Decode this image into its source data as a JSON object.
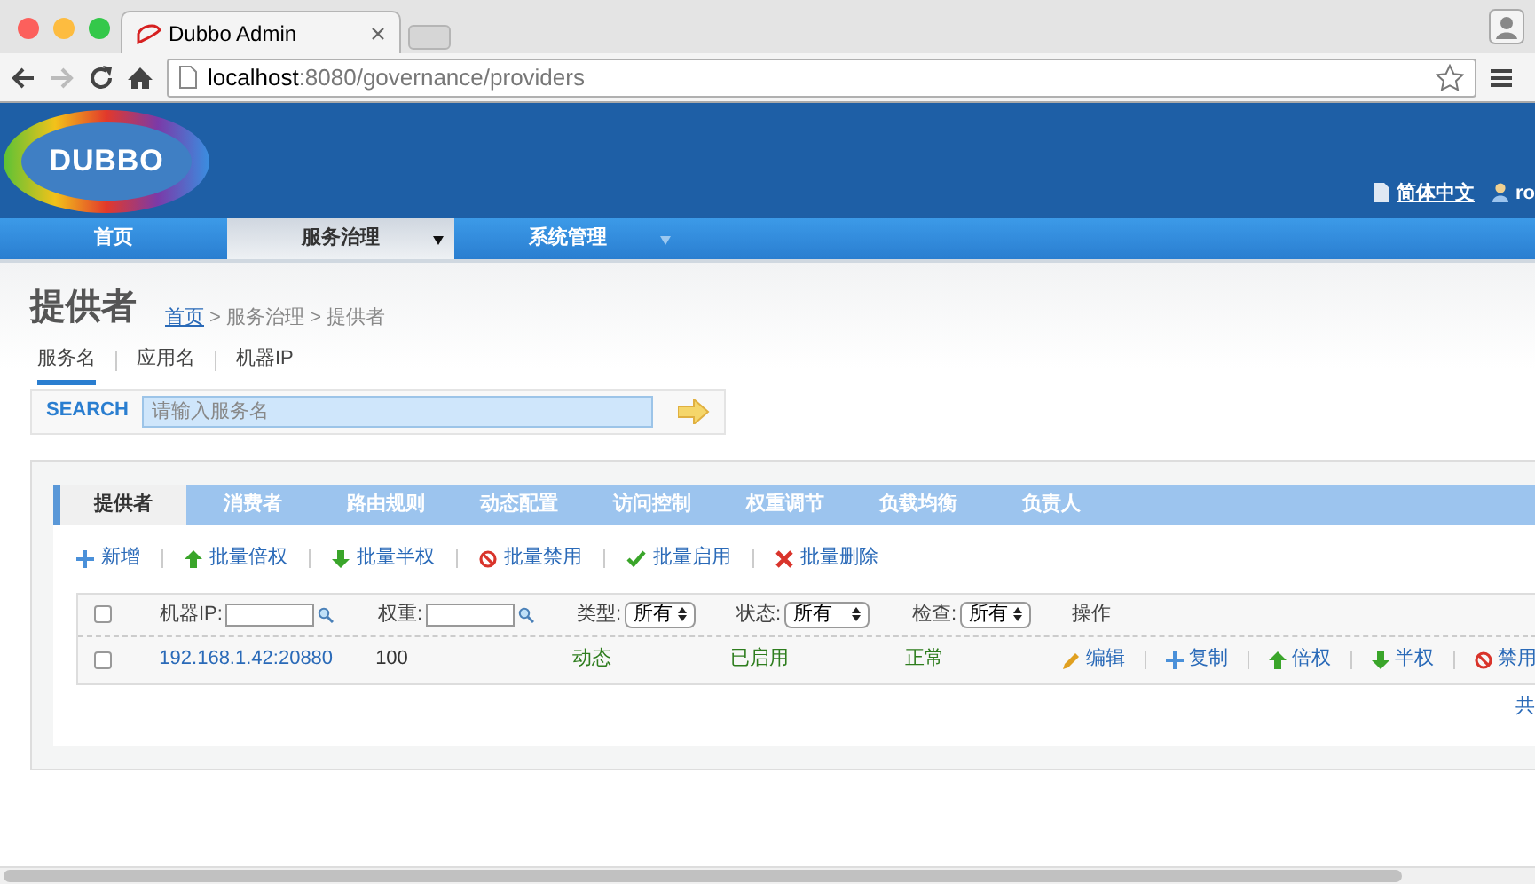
{
  "browser": {
    "tab_title": "Dubbo Admin",
    "url_host": "localhost",
    "url_path": ":8080/governance/providers"
  },
  "header": {
    "logo": "DUBBO",
    "language": "简体中文",
    "user": "ro"
  },
  "nav": [
    {
      "label": "首页",
      "selected": false,
      "dropdown": false
    },
    {
      "label": "服务治理",
      "selected": true,
      "dropdown": true
    },
    {
      "label": "系统管理",
      "selected": false,
      "dropdown": true
    }
  ],
  "page_title": "提供者",
  "breadcrumb": {
    "link": "首页",
    "rest": "> 服务治理 > 提供者"
  },
  "search_tabs": [
    {
      "label": "服务名",
      "selected": true
    },
    {
      "label": "应用名",
      "selected": false
    },
    {
      "label": "机器IP",
      "selected": false
    }
  ],
  "search": {
    "label": "SEARCH",
    "placeholder": "请输入服务名"
  },
  "tabs": [
    {
      "label": "提供者",
      "selected": true
    },
    {
      "label": "消费者",
      "selected": false
    },
    {
      "label": "路由规则",
      "selected": false
    },
    {
      "label": "动态配置",
      "selected": false
    },
    {
      "label": "访问控制",
      "selected": false
    },
    {
      "label": "权重调节",
      "selected": false
    },
    {
      "label": "负载均衡",
      "selected": false
    },
    {
      "label": "负责人",
      "selected": false
    }
  ],
  "actions": [
    {
      "label": "新增",
      "kind": "plus"
    },
    {
      "label": "批量倍权",
      "kind": "up"
    },
    {
      "label": "批量半权",
      "kind": "down"
    },
    {
      "label": "批量禁用",
      "kind": "ban"
    },
    {
      "label": "批量启用",
      "kind": "check"
    },
    {
      "label": "批量删除",
      "kind": "cross"
    }
  ],
  "filters": {
    "checked": false,
    "fields": [
      {
        "label": "机器IP:",
        "kind": "text"
      },
      {
        "label": "权重:",
        "kind": "text"
      },
      {
        "label": "类型:",
        "kind": "select",
        "value": "所有"
      },
      {
        "label": "状态:",
        "kind": "select",
        "value": "所有"
      },
      {
        "label": "检查:",
        "kind": "select",
        "value": "所有"
      }
    ],
    "ops_label": "操作"
  },
  "rows": [
    {
      "checked": false,
      "address": "192.168.1.42:20880",
      "weight": "100",
      "type": "动态",
      "status": "已启用",
      "check": "正常",
      "ops": [
        {
          "label": "编辑",
          "kind": "pencil"
        },
        {
          "label": "复制",
          "kind": "plus"
        },
        {
          "label": "倍权",
          "kind": "up"
        },
        {
          "label": "半权",
          "kind": "down"
        },
        {
          "label": "禁用",
          "kind": "ban"
        }
      ]
    }
  ],
  "footer": "共"
}
